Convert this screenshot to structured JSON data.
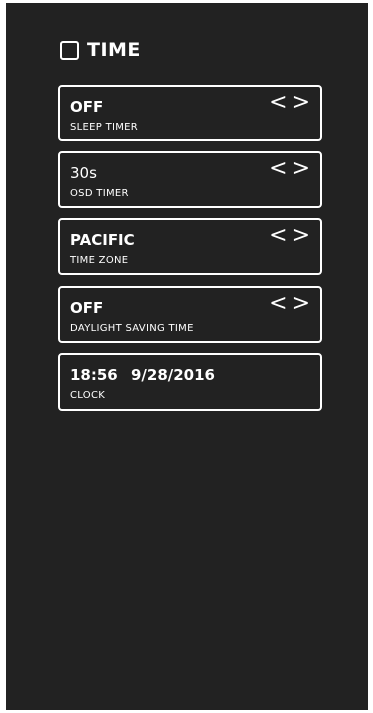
{
  "menu": {
    "title": "TIME"
  },
  "items": [
    {
      "value": "OFF",
      "label": "SLEEP TIMER",
      "prev": "<",
      "next": ">"
    },
    {
      "value": "30s",
      "label": "OSD TIMER",
      "prev": "<",
      "next": ">"
    },
    {
      "value": "PACIFIC",
      "label": "TIME ZONE",
      "prev": "<",
      "next": ">"
    },
    {
      "value": "OFF",
      "label": "DAYLIGHT SAVING TIME",
      "prev": "<",
      "next": ">"
    },
    {
      "value": "18:56  9/28/2016",
      "label": "CLOCK"
    }
  ],
  "colors": {
    "background": "#222222",
    "foreground": "#ffffff"
  }
}
